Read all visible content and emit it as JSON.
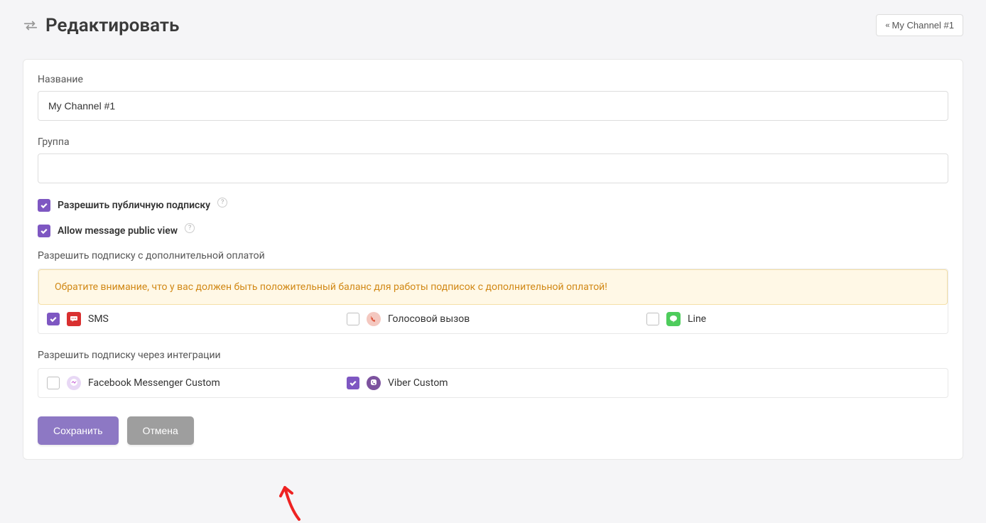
{
  "header": {
    "title": "Редактировать",
    "back_label": "My Channel #1"
  },
  "form": {
    "name_label": "Название",
    "name_value": "My Channel #1",
    "group_label": "Группа",
    "group_value": "",
    "public_subscribe_label": "Разрешить публичную подписку",
    "public_view_label": "Allow message public view",
    "extra_fee_label": "Разрешить подписку с дополнительной оплатой",
    "warning_text": "Обратите внимание, что у вас должен быть положительный баланс для работы подписок с дополнительной оплатой!",
    "integrations_label": "Разрешить подписку через интеграции"
  },
  "extra_options": {
    "sms": "SMS",
    "voice": "Голосовой вызов",
    "line": "Line"
  },
  "integrations": {
    "fb": "Facebook Messenger Custom",
    "viber": "Viber Custom"
  },
  "actions": {
    "save": "Сохранить",
    "cancel": "Отмена"
  }
}
